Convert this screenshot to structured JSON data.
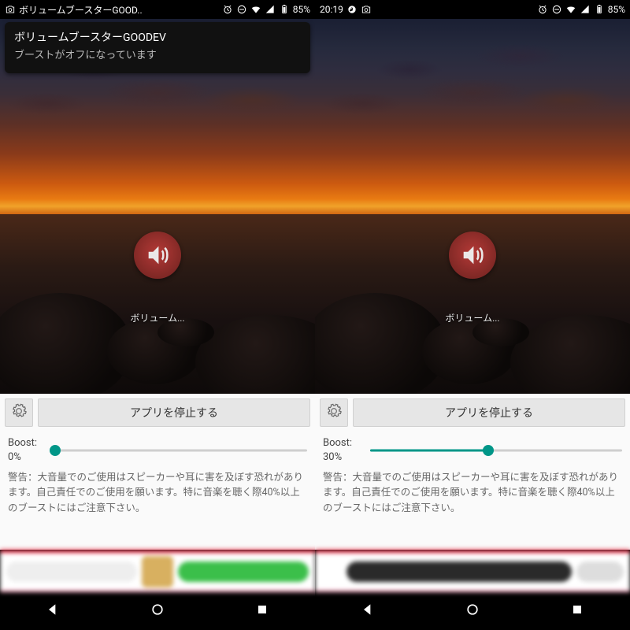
{
  "left": {
    "statusbar": {
      "app_title": "ボリュームブースターGOOD..",
      "battery": "85%"
    },
    "notification": {
      "title": "ボリュームブースターGOODEV",
      "body": "ブーストがオフになっています"
    },
    "app_icon_label": "ボリューム...",
    "panel": {
      "stop_label": "アプリを停止する",
      "boost_label": "Boost:",
      "boost_value": "0%",
      "slider_percent": 0,
      "warning": "警告：大音量でのご使用はスピーカーや耳に害を及ぼす恐れがあります。自己責任でのご使用を願います。特に音楽を聴く際40%以上のブーストにはご注意下さい。"
    }
  },
  "right": {
    "statusbar": {
      "clock": "20:19",
      "battery": "85%"
    },
    "app_icon_label": "ボリューム...",
    "panel": {
      "stop_label": "アプリを停止する",
      "boost_label": "Boost:",
      "boost_value": "30%",
      "slider_percent": 47,
      "warning": "警告：大音量でのご使用はスピーカーや耳に害を及ぼす恐れがあります。自己責任でのご使用を願います。特に音楽を聴く際40%以上のブーストにはご注意下さい。"
    }
  },
  "colors": {
    "accent": "#009688",
    "danger": "#e5203a"
  }
}
